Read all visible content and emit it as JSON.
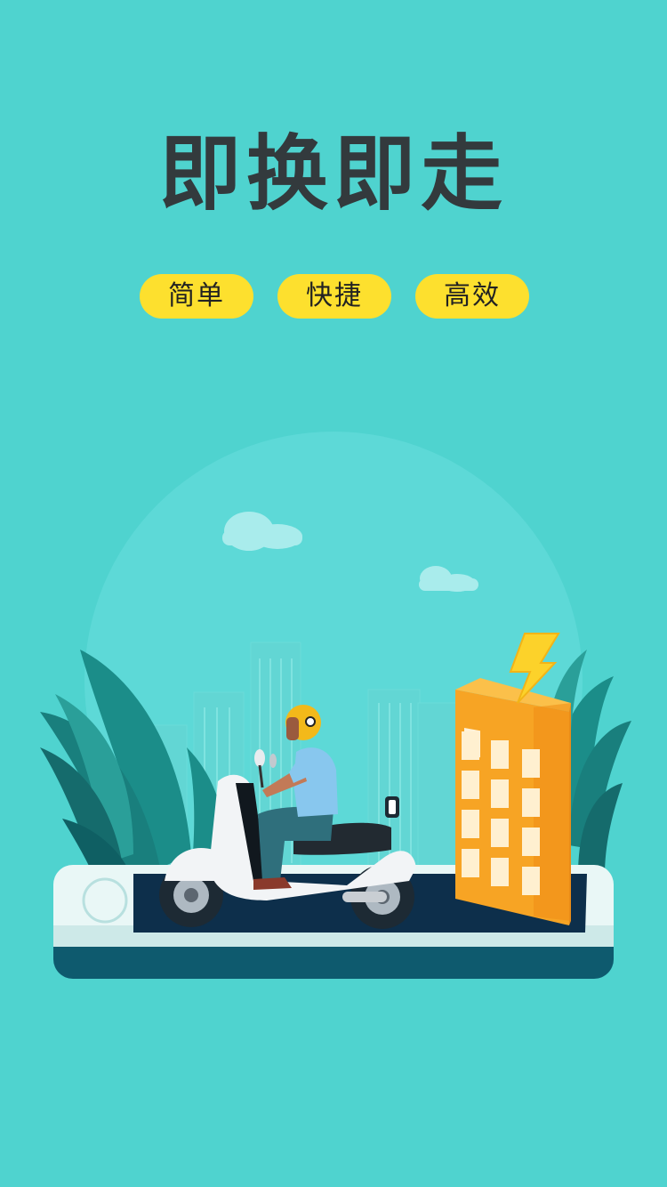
{
  "headline": "即换即走",
  "tags": [
    "简单",
    "快捷",
    "高效"
  ],
  "colors": {
    "background": "#4fd3cf",
    "tag_background": "#fde02e",
    "headline_text": "#333a3d",
    "phone_base": "#0e5a6e",
    "building": "#f7a424"
  },
  "illustration": "rider-on-scooter-phone-battery-building"
}
